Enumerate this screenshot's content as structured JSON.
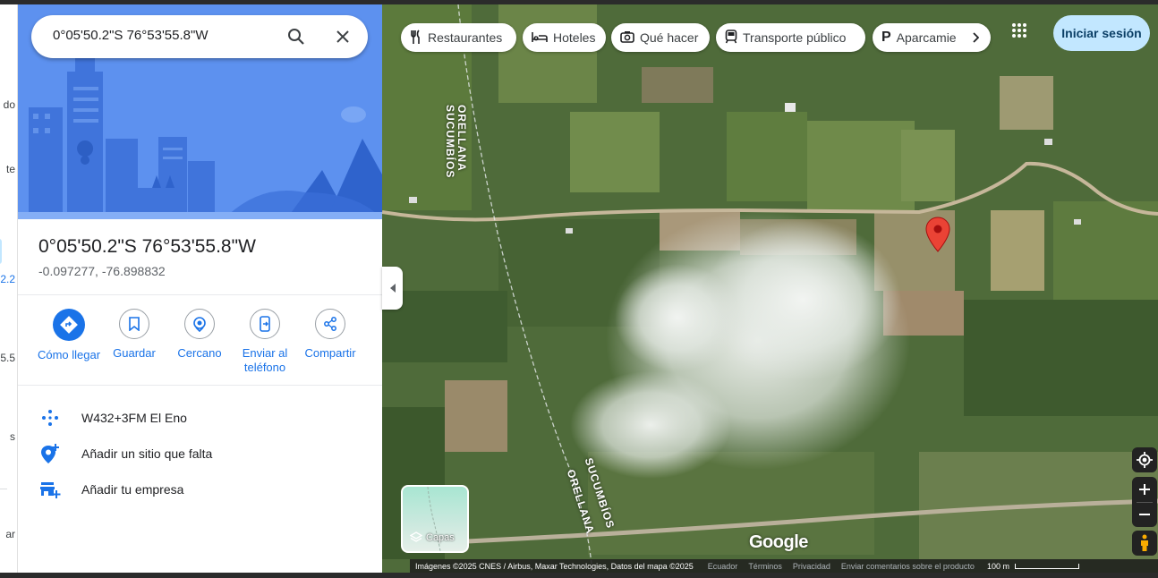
{
  "rail": {
    "items": [
      "do",
      "te",
      "2.2",
      "5.5",
      "s",
      "ar"
    ]
  },
  "search": {
    "value": "0°05'50.2\"S 76°53'55.8\"W"
  },
  "place": {
    "title": "0°05'50.2\"S 76°53'55.8\"W",
    "coords": "-0.097277, -76.898832"
  },
  "actions": [
    {
      "label": "Cómo llegar",
      "icon": "directions-icon"
    },
    {
      "label": "Guardar",
      "icon": "bookmark-icon"
    },
    {
      "label": "Cercano",
      "icon": "nearby-icon"
    },
    {
      "label": "Enviar al teléfono",
      "icon": "send-to-phone-icon"
    },
    {
      "label": "Compartir",
      "icon": "share-icon"
    }
  ],
  "details": [
    {
      "text": "W432+3FM El Eno",
      "icon": "plus-code-icon"
    },
    {
      "text": "Añadir un sitio que falta",
      "icon": "add-location-icon"
    },
    {
      "text": "Añadir tu empresa",
      "icon": "add-business-icon"
    }
  ],
  "chips": [
    {
      "label": "Restaurantes",
      "icon": "restaurant-icon"
    },
    {
      "label": "Hoteles",
      "icon": "hotel-icon"
    },
    {
      "label": "Qué hacer",
      "icon": "camera-icon"
    },
    {
      "label": "Transporte público",
      "icon": "transit-icon"
    },
    {
      "label": "Aparcamie",
      "icon": "parking-icon"
    }
  ],
  "header": {
    "signin": "Iniciar sesión"
  },
  "map": {
    "labels": [
      "SUCUMBÍOS",
      "ORELLANA",
      "SUCUMBÍOS",
      "ORELLANA"
    ],
    "layers_label": "Capas",
    "logo": "Google",
    "pin_color": "#ea4335"
  },
  "footer": {
    "attribution": "Imágenes ©2025 CNES / Airbus, Maxar Technologies, Datos del mapa ©2025",
    "links": [
      "Ecuador",
      "Términos",
      "Privacidad",
      "Enviar comentarios sobre el producto"
    ],
    "scale": "100 m"
  },
  "colors": {
    "accent": "#1a73e8",
    "signin_bg": "#c2e7ff"
  }
}
